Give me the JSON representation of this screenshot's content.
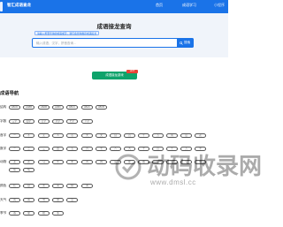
{
  "header": {
    "site_title": "智汇成语查龙",
    "nav": [
      "首页",
      "成语学习",
      "小程序"
    ]
  },
  "hero": {
    "title": "成语接龙查询",
    "tagline": "请输入想要查询的成语或字，我们会给你推荐成语接龙",
    "search": {
      "placeholder": "输入成语，汉字，拼音查询...",
      "button_label": "搜索"
    }
  },
  "cta": {
    "label": "成语接龙游戏",
    "badge": "HOT"
  },
  "section": {
    "title": "成语导航"
  },
  "rows": [
    {
      "label": "结构",
      "chips": [
        "ABCD",
        "AABB",
        "ABAB",
        "AABC",
        "ABCC",
        "ABAC",
        "ABCB"
      ]
    },
    {
      "label": "字数",
      "chips": [
        "三字",
        "四字",
        "五字",
        "六字",
        "七字",
        "八字"
      ]
    },
    {
      "label": "首字",
      "chips": [
        "一",
        "不",
        "无",
        "人",
        "心",
        "大",
        "天",
        "自",
        "百",
        "千",
        "万",
        "风",
        "山",
        "花"
      ]
    },
    {
      "label": "数字",
      "chips": [
        "一",
        "二",
        "三",
        "四",
        "五",
        "六",
        "七",
        "八",
        "九",
        "十",
        "百",
        "千",
        "万",
        "半"
      ]
    },
    {
      "label": "动物",
      "chips": [
        "龙",
        "虎",
        "马",
        "牛",
        "羊",
        "鸡",
        "狗",
        "鼠",
        "蛇",
        "猴",
        "兔",
        "猪",
        "鸟",
        "鱼",
        "鱼",
        "龟"
      ]
    },
    {
      "label": "颜色",
      "chips": [
        "红",
        "白",
        "黑",
        "青",
        "绿",
        "黄"
      ]
    },
    {
      "label": "天气",
      "chips": [
        "风",
        "雨",
        "雪",
        "雷",
        "云"
      ]
    },
    {
      "label": "季节",
      "chips": [
        "春",
        "夏",
        "秋",
        "冬"
      ]
    }
  ],
  "watermark": {
    "text": "动码收录网",
    "url": "www.dmsl.cc"
  },
  "colors": {
    "brand": "#1a73e8",
    "hero_bg": "#f0f4fa",
    "cta": "#0fa36b",
    "badge": "#ea4335"
  }
}
